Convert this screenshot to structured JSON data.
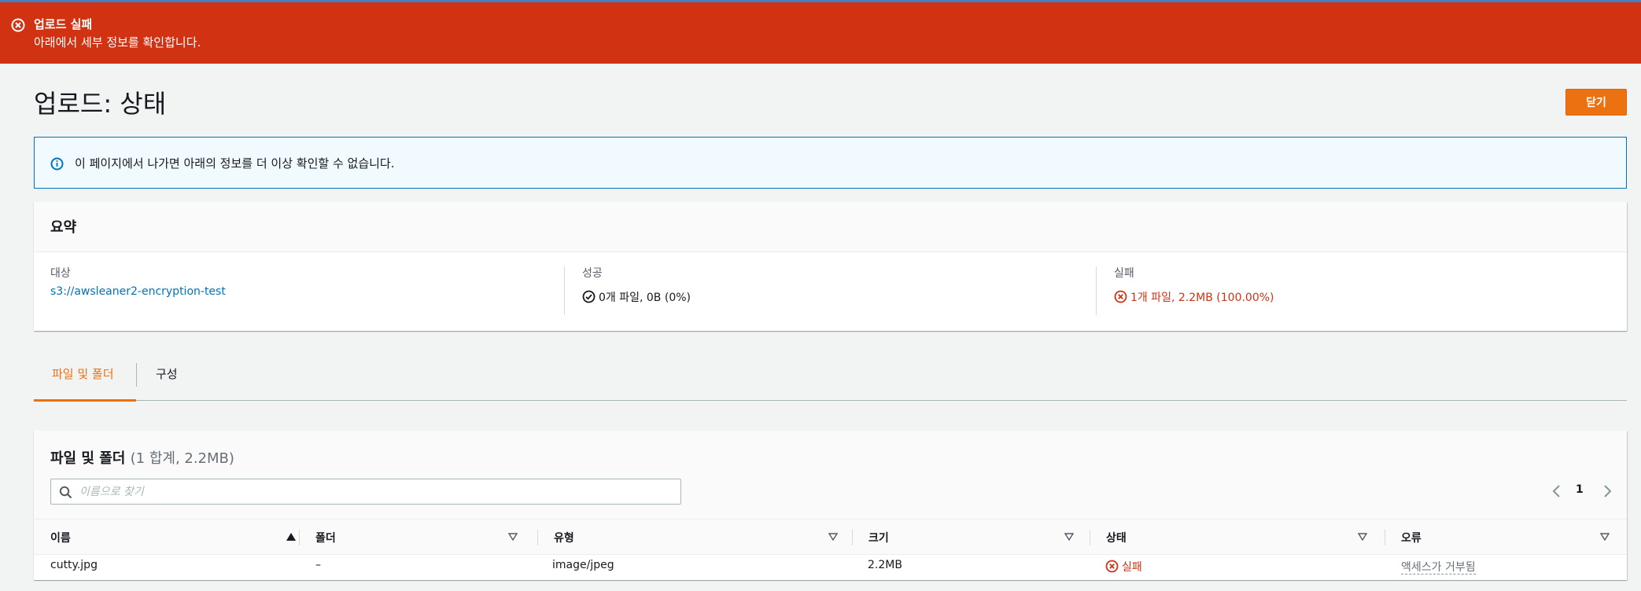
{
  "flash": {
    "title": "업로드 실패",
    "subtitle": "아래에서 세부 정보를 확인합니다.",
    "icon": "error-circle-icon",
    "color": "#d13212"
  },
  "header": {
    "title": "업로드: 상태",
    "close_label": "닫기",
    "accent": "#ec7211"
  },
  "info": {
    "text": "이 페이지에서 나가면 아래의 정보를 더 이상 확인할 수 없습니다."
  },
  "summary": {
    "title": "요약",
    "destination": {
      "label": "대상",
      "value": "s3://awsleaner2-encryption-test"
    },
    "succeeded": {
      "label": "성공",
      "value": "0개 파일, 0B (0%)"
    },
    "failed": {
      "label": "실패",
      "value": "1개 파일, 2.2MB (100.00%)"
    }
  },
  "tabs": [
    {
      "label": "파일 및 폴더",
      "active": true
    },
    {
      "label": "구성",
      "active": false
    }
  ],
  "table": {
    "title": "파일 및 폴더",
    "count": "(1 합계, 2.2MB)",
    "search_placeholder": "이름으로 찾기",
    "page": "1",
    "columns": [
      "이름",
      "폴더",
      "유형",
      "크기",
      "상태",
      "오류"
    ],
    "rows": [
      {
        "name": "cutty.jpg",
        "folder": "–",
        "type": "image/jpeg",
        "size": "2.2MB",
        "status": "실패",
        "error": "액세스가 거부됨"
      }
    ]
  }
}
